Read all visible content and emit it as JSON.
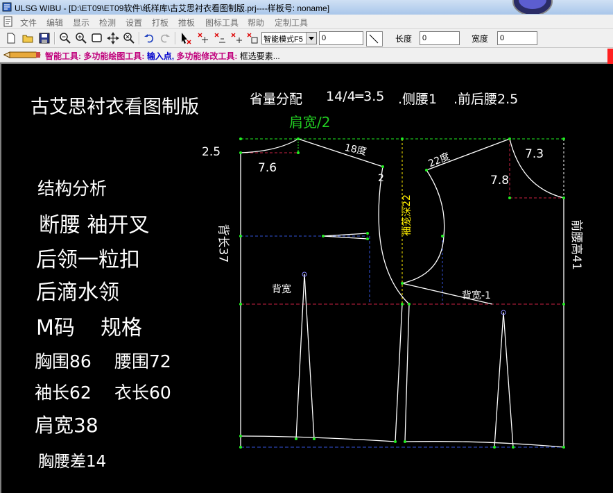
{
  "window": {
    "title": "ULSG WIBU - [D:\\ET09\\ET09软件\\纸样库\\古艾思衬衣看图制版.prj----样板号: noname]"
  },
  "menu": {
    "items": [
      "文件",
      "编辑",
      "显示",
      "检测",
      "设置",
      "打板",
      "推板",
      "图标工具",
      "帮助",
      "定制工具"
    ]
  },
  "toolbar": {
    "mode_select": "智能模式F5",
    "value_input": "0",
    "length_label": "长度",
    "length_value": "0",
    "width_label": "宽度",
    "width_value": "0"
  },
  "prompt": {
    "smart_tool": "智能工具:",
    "draw_tool": "多功能绘图工具:",
    "input_point": "输入点,",
    "modify_tool": "多功能修改工具:",
    "select_elements": "框选要素..."
  },
  "notes": {
    "heading": "古艾思衬衣看图制版",
    "dart_allocation": "省量分配",
    "dart_calc": "14/4═3.5",
    "side_waist": ".侧腰1",
    "front_back_waist": ".前后腰2.5",
    "structure": "结构分析",
    "line1": "断腰 袖开叉",
    "line2": "后领一粒扣",
    "line3": "后滴水领",
    "size_code": "M码",
    "spec": "规格",
    "chest": "胸围86",
    "waist": "腰围72",
    "sleeve": "袖长62",
    "length": "衣长60",
    "shoulder": "肩宽38",
    "chest_waist_diff": "胸腰差14"
  },
  "pattern_labels": {
    "shoulder_half": "肩宽/2",
    "back_neck_drop": "2.5",
    "back_neck_width": "7.6",
    "back_shoulder_angle": "18度",
    "shoulder_drop": "2",
    "armhole_depth": "袖笼深22",
    "front_shoulder_angle": "22度",
    "front_neck_width": "7.3",
    "front_neck_depth": "7.8",
    "back_length": "背长37",
    "front_waist_height": "前腰高41",
    "back_width": "背宽",
    "back_width_minus": "背宽-1"
  },
  "colors": {
    "title_green": "#22cc22",
    "armhole_yellow": "#ffee00",
    "point_green": "#22ee22",
    "guide_blue": "#3355dd",
    "guide_red": "#cc2244",
    "prompt_magenta": "#c0007c",
    "prompt_blue": "#0000cc"
  }
}
